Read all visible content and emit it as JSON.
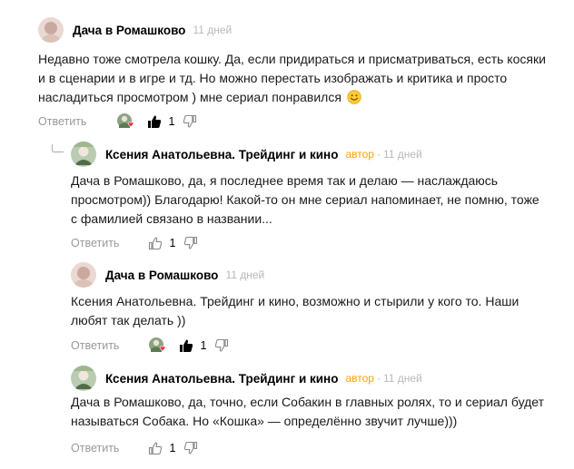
{
  "comments": [
    {
      "author": "Дача в Ромашково",
      "badge": "",
      "time": "11 дней",
      "lines": [
        "Недавно тоже смотрела кошку. Да, если придираться и присматриваться, есть косяки",
        "и в сценарии и в игре и тд. Но можно перестать изображать и критика и просто",
        "насладиться просмотром ) мне сериал понравился"
      ],
      "reply_label": "Ответить",
      "likes": "1",
      "liked": true
    },
    {
      "author": "Ксения Анатольевна. Трейдинг и кино",
      "badge": "автор",
      "time": "11 дней",
      "lines": [
        "Дача в Ромашково, да, я последнее время так и делаю — наслаждаюсь",
        "просмотром)) Благодарю! Какой-то он мне сериал напоминает, не помню, тоже",
        "с фамилией связано в названии..."
      ],
      "reply_label": "Ответить",
      "likes": "1",
      "liked": false
    },
    {
      "author": "Дача в Ромашково",
      "badge": "",
      "time": "11 дней",
      "lines": [
        "Ксения Анатольевна. Трейдинг и кино, возможно и стырили у кого то. Наши",
        "любят так делать ))"
      ],
      "reply_label": "Ответить",
      "likes": "1",
      "liked": true
    },
    {
      "author": "Ксения Анатольевна. Трейдинг и кино",
      "badge": "автор",
      "time": "11 дней",
      "lines": [
        "Дача в Ромашково, да, точно, если Собакин в главных ролях, то и сериал будет",
        "называться Собака. Но «Кошка» — определённо звучит лучше)))"
      ],
      "reply_label": "Ответить",
      "likes": "1",
      "liked": false
    }
  ],
  "colors": {
    "author_badge": "#ff9f0a",
    "muted": "#9a9a9a",
    "heart": "#e8343f"
  },
  "icons": [
    "reply-arrow-icon",
    "thumbs-up-icon",
    "thumbs-down-icon",
    "heart-icon",
    "smile-emoji-icon"
  ]
}
